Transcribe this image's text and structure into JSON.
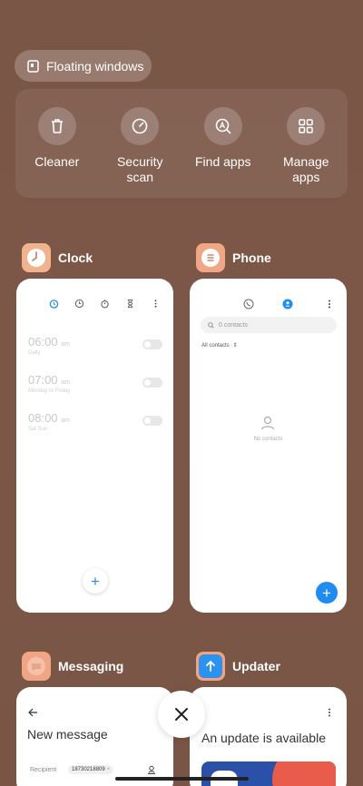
{
  "floating_windows": {
    "label": "Floating windows"
  },
  "tools": [
    {
      "label": "Cleaner",
      "icon": "trash-icon"
    },
    {
      "label": "Security\nscan",
      "icon": "security-gauge-icon"
    },
    {
      "label": "Find apps",
      "icon": "find-apps-icon"
    },
    {
      "label": "Manage\napps",
      "icon": "grid-icon"
    }
  ],
  "apps": {
    "clock": {
      "name": "Clock",
      "alarms": [
        {
          "time": "06:00",
          "ampm": "am",
          "label": "Daily"
        },
        {
          "time": "07:00",
          "ampm": "am",
          "label": "Monday to Friday"
        },
        {
          "time": "08:00",
          "ampm": "am",
          "label": "Sat Sun"
        }
      ]
    },
    "phone": {
      "name": "Phone",
      "search_placeholder": "0 contacts",
      "filter": "All contacts",
      "empty": "No contacts"
    },
    "messaging": {
      "name": "Messaging",
      "title": "New message",
      "recipient_label": "Recipient",
      "recipient_value": "18730218809"
    },
    "updater": {
      "name": "Updater",
      "message": "An update is available"
    }
  },
  "colors": {
    "accent": "#1e8cf0",
    "background": "#7a5646"
  }
}
